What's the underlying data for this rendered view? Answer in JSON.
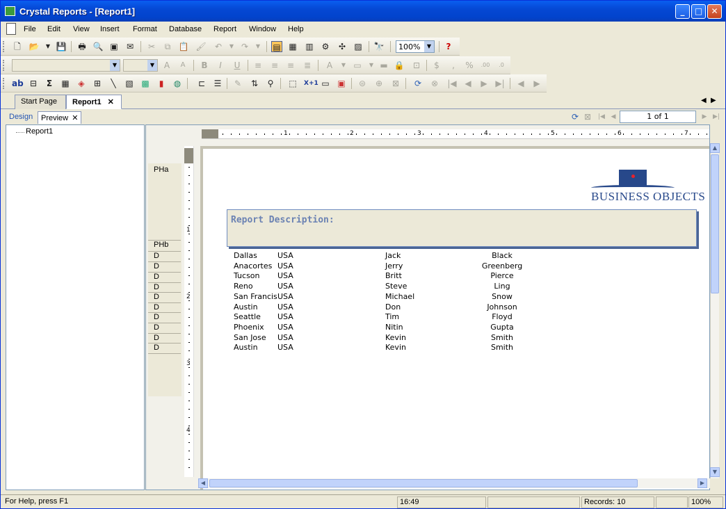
{
  "window": {
    "title": "Crystal Reports - [Report1]"
  },
  "menu": [
    "File",
    "Edit",
    "View",
    "Insert",
    "Format",
    "Database",
    "Report",
    "Window",
    "Help"
  ],
  "toolbar": {
    "zoom": "100%"
  },
  "tabs": {
    "start_page": "Start Page",
    "report1": "Report1",
    "close": "✕"
  },
  "subtabs": {
    "design": "Design",
    "preview": "Preview"
  },
  "paging": {
    "page_indicator": "1 of 1"
  },
  "tree": {
    "root": "Report1"
  },
  "sections": [
    {
      "label": "PHa"
    },
    {
      "label": "PHb"
    },
    {
      "label": "D"
    },
    {
      "label": "D"
    },
    {
      "label": "D"
    },
    {
      "label": "D"
    },
    {
      "label": "D"
    },
    {
      "label": "D"
    },
    {
      "label": "D"
    },
    {
      "label": "D"
    },
    {
      "label": "D"
    },
    {
      "label": "D"
    }
  ],
  "ruler": {
    "h_labels": [
      "1",
      "2",
      "3",
      "4",
      "5",
      "6",
      "7"
    ],
    "v_labels": [
      "1",
      "2",
      "3",
      "4"
    ]
  },
  "report": {
    "logo_text": "BUSINESS OBJECTS",
    "description_label": "Report Description:",
    "rows": [
      {
        "city": "Dallas",
        "country": "USA",
        "first": "Jack",
        "last": "Black"
      },
      {
        "city": "Anacortes",
        "country": "USA",
        "first": "Jerry",
        "last": "Greenberg"
      },
      {
        "city": "Tucson",
        "country": "USA",
        "first": "Britt",
        "last": "Pierce"
      },
      {
        "city": "Reno",
        "country": "USA",
        "first": "Steve",
        "last": "Ling"
      },
      {
        "city": "San Francis",
        "country": "USA",
        "first": "Michael",
        "last": "Snow"
      },
      {
        "city": "Austin",
        "country": "USA",
        "first": "Don",
        "last": "Johnson"
      },
      {
        "city": "Seattle",
        "country": "USA",
        "first": "Tim",
        "last": "Floyd"
      },
      {
        "city": "Phoenix",
        "country": "USA",
        "first": "Nitin",
        "last": "Gupta"
      },
      {
        "city": "San Jose",
        "country": "USA",
        "first": "Kevin",
        "last": "Smith"
      },
      {
        "city": "Austin",
        "country": "USA",
        "first": "Kevin",
        "last": "Smith"
      }
    ]
  },
  "status": {
    "help": "For Help, press F1",
    "time": "16:49",
    "records": "Records: 10",
    "zoom": "100%"
  },
  "colors": {
    "title_bar": "#0548d4",
    "accent": "#27488a",
    "logo_dot": "#e8222b"
  }
}
